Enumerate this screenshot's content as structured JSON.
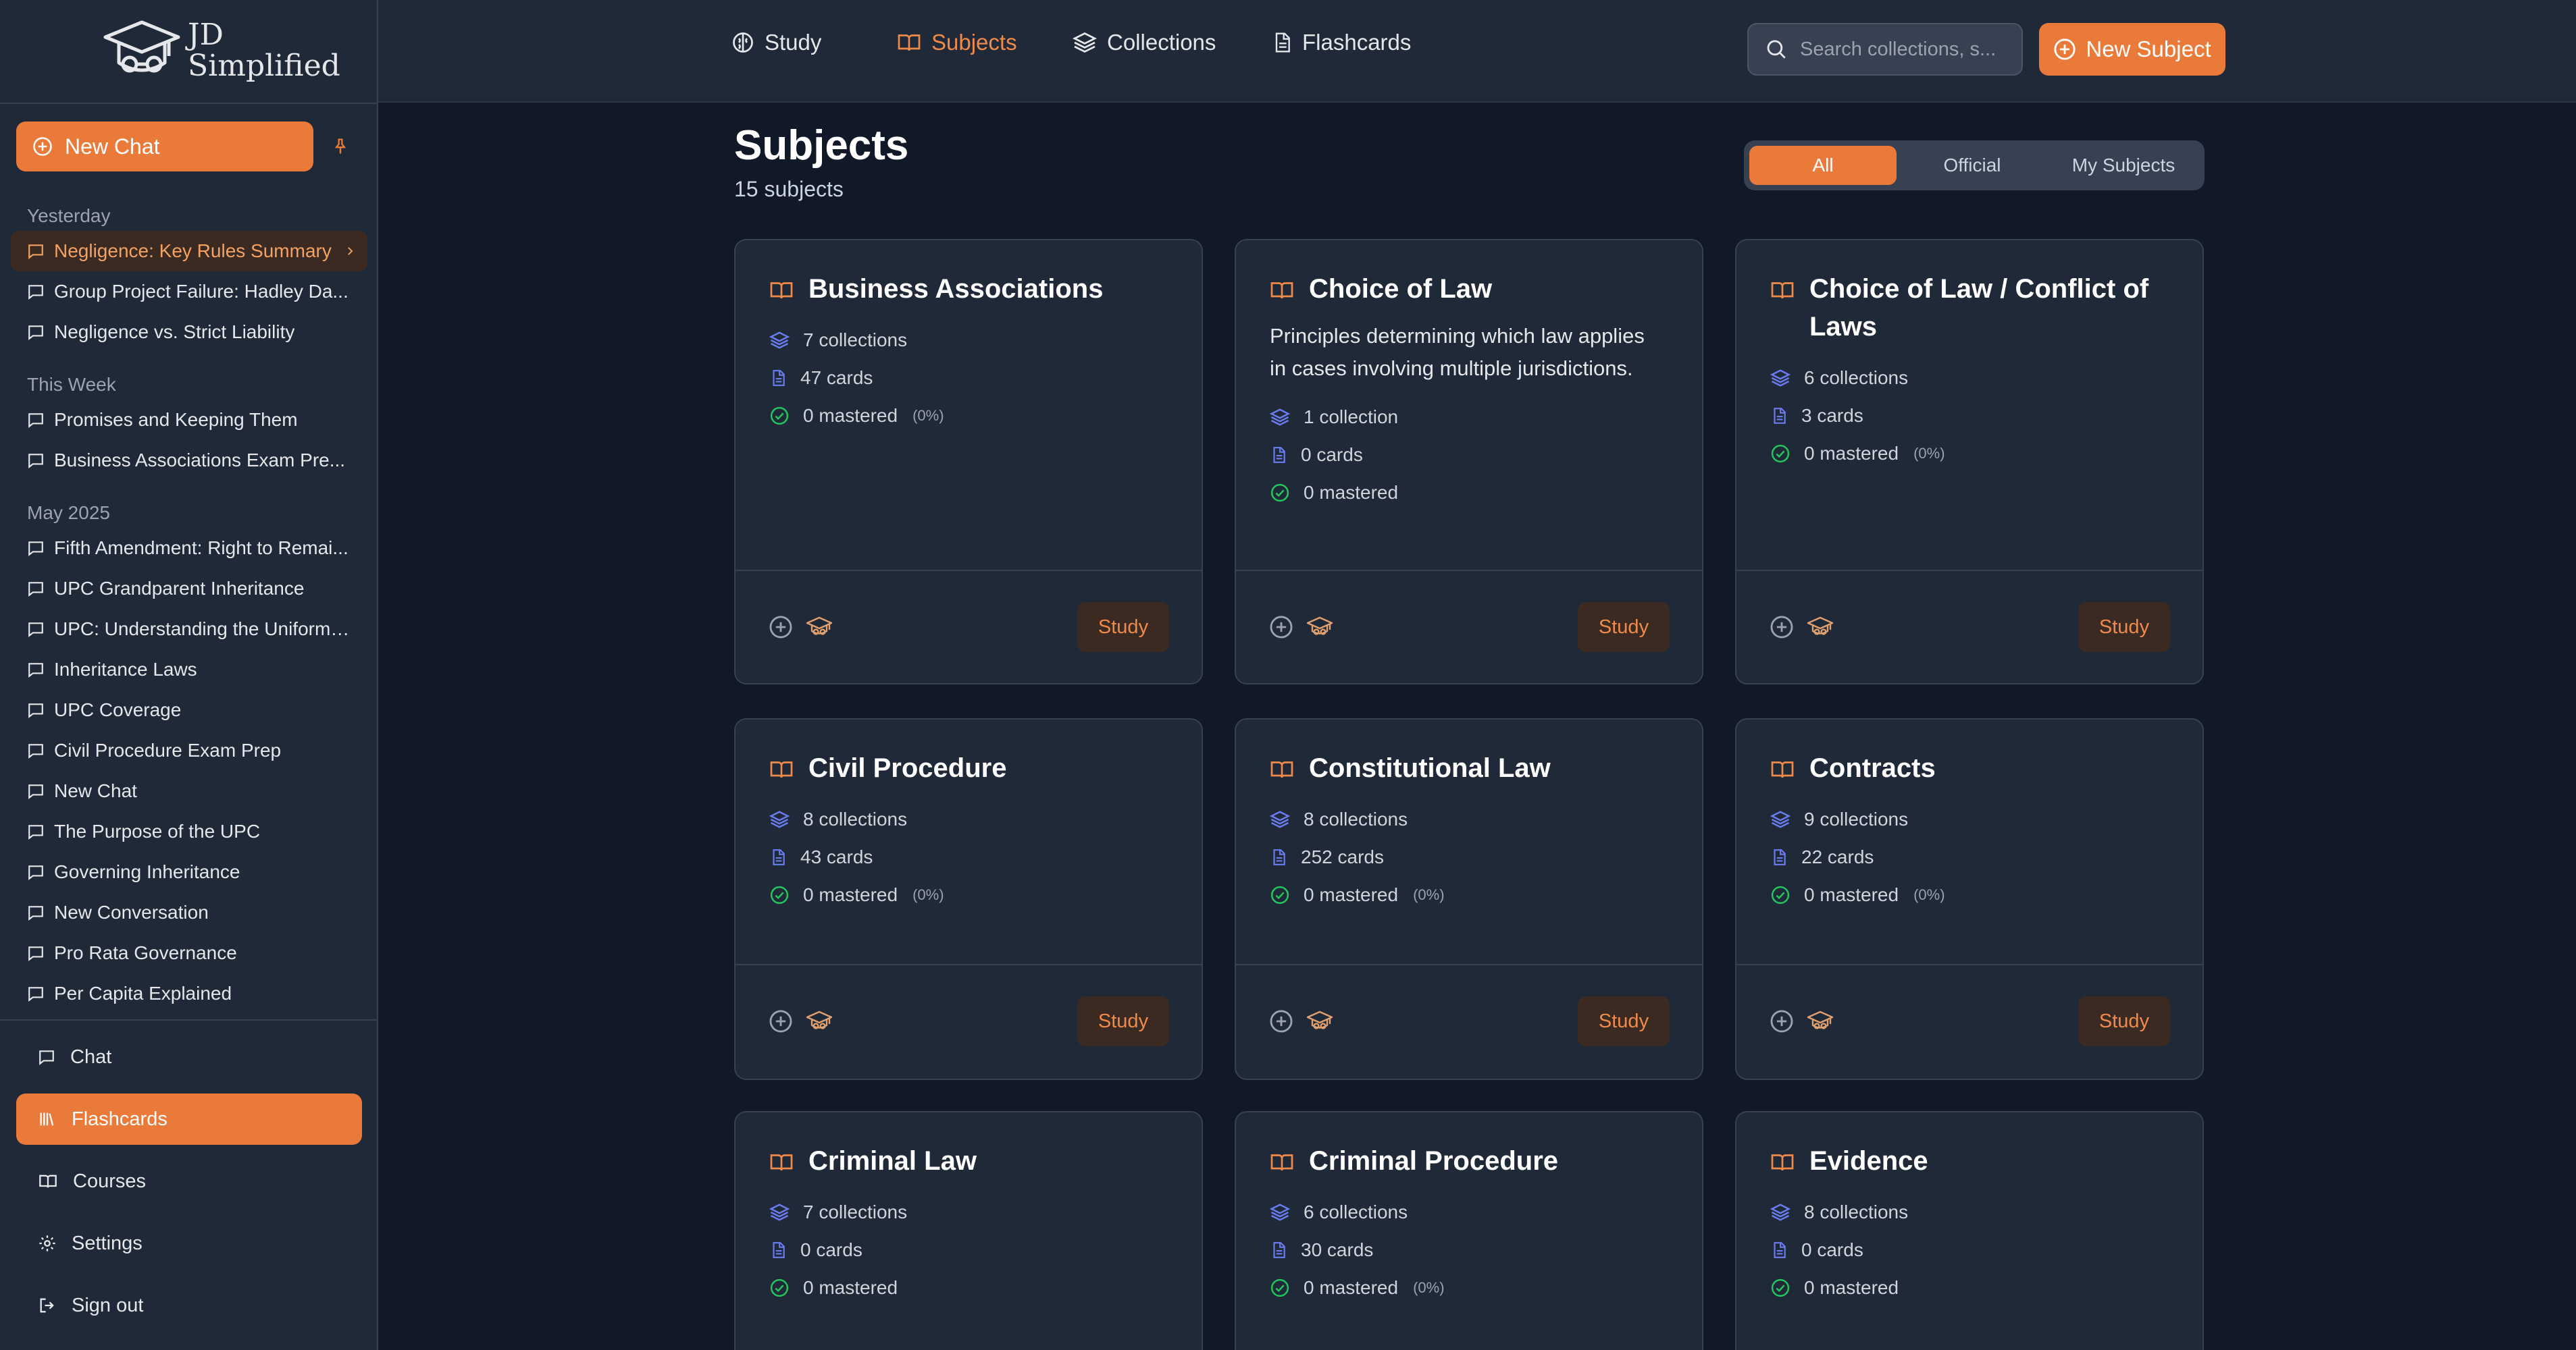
{
  "app": {
    "logo_line1": "JD",
    "logo_line2": "Simplified"
  },
  "sidebar": {
    "new_chat_label": "New Chat",
    "groups": [
      {
        "label": "Yesterday",
        "items": [
          {
            "label": "Negligence: Key Rules Summary",
            "active": true
          },
          {
            "label": "Group Project Failure: Hadley Da..."
          },
          {
            "label": "Negligence vs. Strict Liability"
          }
        ]
      },
      {
        "label": "This Week",
        "items": [
          {
            "label": "Promises and Keeping Them"
          },
          {
            "label": "Business Associations Exam Pre..."
          }
        ]
      },
      {
        "label": "May 2025",
        "items": [
          {
            "label": "Fifth Amendment: Right to Remai..."
          },
          {
            "label": "UPC Grandparent Inheritance"
          },
          {
            "label": "UPC: Understanding the Uniform ..."
          },
          {
            "label": "Inheritance Laws"
          },
          {
            "label": "UPC Coverage"
          },
          {
            "label": "Civil Procedure Exam Prep"
          },
          {
            "label": "New Chat"
          },
          {
            "label": "The Purpose of the UPC"
          },
          {
            "label": "Governing Inheritance"
          },
          {
            "label": "New Conversation"
          },
          {
            "label": "Pro Rata Governance"
          },
          {
            "label": "Per Capita Explained"
          }
        ]
      }
    ],
    "bottom_nav": [
      {
        "label": "Chat",
        "icon": "chat-icon"
      },
      {
        "label": "Flashcards",
        "icon": "library-icon",
        "active": true
      },
      {
        "label": "Courses",
        "icon": "book-icon"
      },
      {
        "label": "Settings",
        "icon": "gear-icon"
      },
      {
        "label": "Sign out",
        "icon": "sign-out-icon"
      }
    ]
  },
  "topbar": {
    "nav": [
      {
        "label": "Study",
        "icon": "brain-icon"
      },
      {
        "label": "Subjects",
        "icon": "open-book-icon",
        "active": true
      },
      {
        "label": "Collections",
        "icon": "layers-icon"
      },
      {
        "label": "Flashcards",
        "icon": "document-icon"
      }
    ],
    "search_placeholder": "Search collections, s...",
    "new_subject_label": "New Subject"
  },
  "main": {
    "title": "Subjects",
    "subtitle": "15 subjects",
    "filters": [
      "All",
      "Official",
      "My Subjects"
    ],
    "active_filter": "All",
    "study_label": "Study",
    "subjects": [
      {
        "title": "Business Associations",
        "collections": "7 collections",
        "cards": "47 cards",
        "mastered": "0 mastered",
        "pct": "(0%)"
      },
      {
        "title": "Choice of Law",
        "description": "Principles determining which law applies in cases involving multiple jurisdictions.",
        "collections": "1 collection",
        "cards": "0 cards",
        "mastered": "0 mastered"
      },
      {
        "title": "Choice of Law / Conflict of Laws",
        "collections": "6 collections",
        "cards": "3 cards",
        "mastered": "0 mastered",
        "pct": "(0%)"
      },
      {
        "title": "Civil Procedure",
        "collections": "8 collections",
        "cards": "43 cards",
        "mastered": "0 mastered",
        "pct": "(0%)"
      },
      {
        "title": "Constitutional Law",
        "collections": "8 collections",
        "cards": "252 cards",
        "mastered": "0 mastered",
        "pct": "(0%)"
      },
      {
        "title": "Contracts",
        "collections": "9 collections",
        "cards": "22 cards",
        "mastered": "0 mastered",
        "pct": "(0%)"
      },
      {
        "title": "Criminal Law",
        "collections": "7 collections",
        "cards": "0 cards",
        "mastered": "0 mastered"
      },
      {
        "title": "Criminal Procedure",
        "collections": "6 collections",
        "cards": "30 cards",
        "mastered": "0 mastered",
        "pct": "(0%)"
      },
      {
        "title": "Evidence",
        "collections": "8 collections",
        "cards": "0 cards",
        "mastered": "0 mastered"
      }
    ]
  },
  "colors": {
    "accent": "#ea7a3a",
    "background": "#111827",
    "surface": "#1f2937",
    "stat_icon_blue": "#6b7cf0",
    "stat_icon_green": "#22c55e"
  }
}
